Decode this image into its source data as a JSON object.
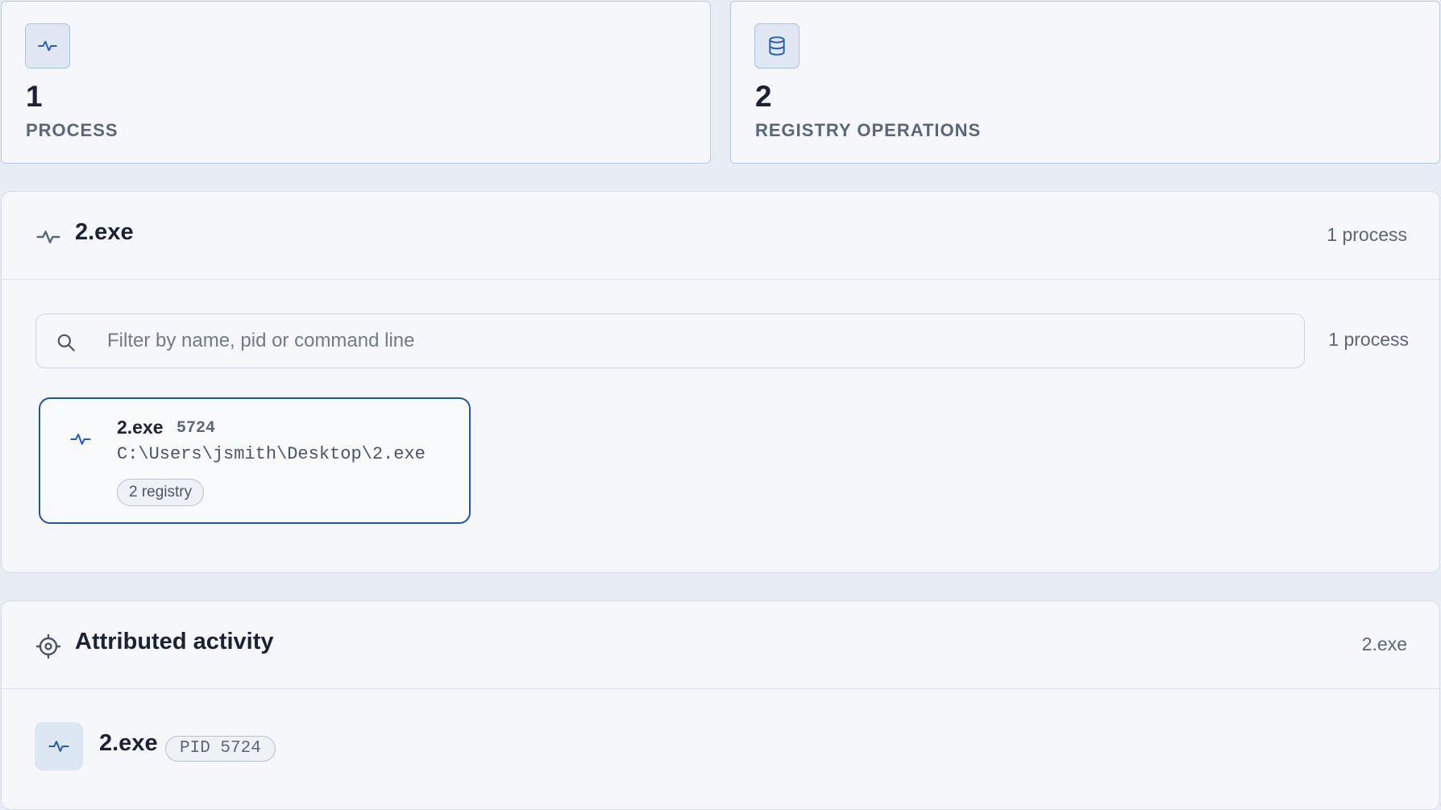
{
  "stats": [
    {
      "icon": "pulse-icon",
      "value": "1",
      "label": "PROCESS"
    },
    {
      "icon": "database-icon",
      "value": "2",
      "label": "REGISTRY OPERATIONS"
    }
  ],
  "process_panel": {
    "title": "2.exe",
    "meta": "1 process",
    "search": {
      "placeholder": "Filter by name, pid or command line",
      "value": "",
      "count": "1 process"
    },
    "processes": [
      {
        "name": "2.exe",
        "pid": "5724",
        "path": "C:\\Users\\jsmith\\Desktop\\2.exe",
        "badge": "2 registry"
      }
    ]
  },
  "activity_panel": {
    "title": "Attributed activity",
    "meta": "2.exe",
    "entry": {
      "name": "2.exe",
      "pid_label": "PID 5724"
    }
  },
  "colors": {
    "accent": "#2055a8",
    "background": "#e8edf5",
    "card": "#f5f7fb"
  }
}
